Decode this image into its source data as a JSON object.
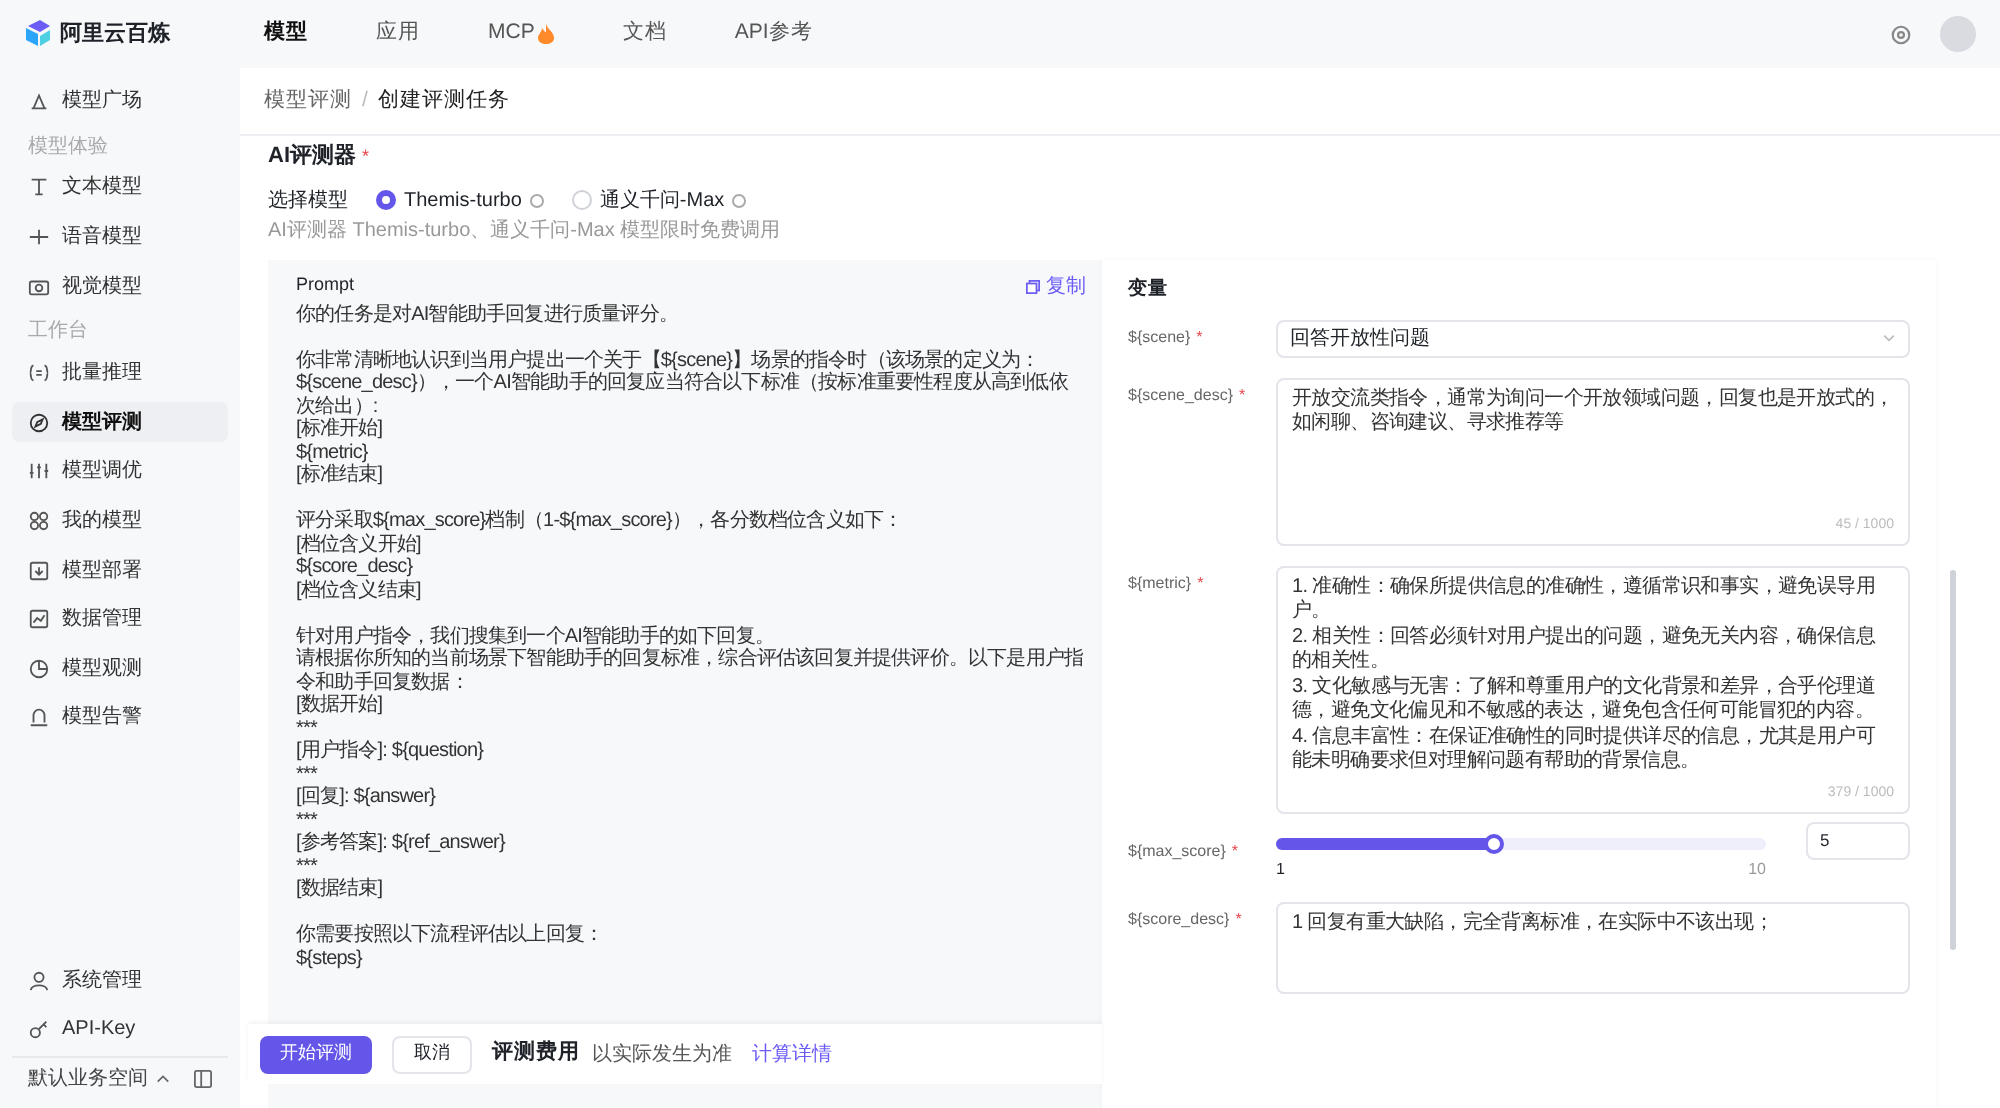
{
  "brand": "阿里云百炼",
  "top_nav": [
    {
      "label": "模型",
      "selected": true,
      "hot": false
    },
    {
      "label": "应用",
      "selected": false,
      "hot": false
    },
    {
      "label": "MCP",
      "selected": false,
      "hot": true
    },
    {
      "label": "文档",
      "selected": false,
      "hot": false
    },
    {
      "label": "API参考",
      "selected": false,
      "hot": false
    }
  ],
  "sidebar": {
    "groups": [
      {
        "items": [
          {
            "label": "模型广场",
            "selected": false
          }
        ]
      },
      {
        "heading": "模型体验",
        "items": [
          {
            "label": "文本模型",
            "selected": false
          },
          {
            "label": "语音模型",
            "selected": false
          },
          {
            "label": "视觉模型",
            "selected": false
          }
        ]
      },
      {
        "heading": "工作台",
        "items": [
          {
            "label": "批量推理",
            "selected": false
          },
          {
            "label": "模型评测",
            "selected": true
          },
          {
            "label": "模型调优",
            "selected": false
          },
          {
            "label": "我的模型",
            "selected": false
          },
          {
            "label": "模型部署",
            "selected": false
          },
          {
            "label": "数据管理",
            "selected": false
          },
          {
            "label": "模型观测",
            "selected": false
          },
          {
            "label": "模型告警",
            "selected": false
          }
        ]
      }
    ],
    "bottom_items": [
      {
        "label": "系统管理"
      },
      {
        "label": "API-Key"
      }
    ],
    "workspace": "默认业务空间"
  },
  "breadcrumb": {
    "items": [
      "模型评测",
      "创建评测任务"
    ],
    "separator": "/"
  },
  "evaluator": {
    "title": "AI评测器",
    "required_mark": "*",
    "label": "选择模型",
    "options": [
      {
        "label": "Themis-turbo",
        "selected": true
      },
      {
        "label": "通义千问-Max",
        "selected": false
      }
    ],
    "hint": "AI评测器 Themis-turbo、通义千问-Max 模型限时免费调用"
  },
  "prompt": {
    "title": "Prompt",
    "copy": "复制",
    "paragraphs": [
      [
        "你的任务是对AI智能助手回复进行质量评分。"
      ],
      [
        "你非常清晰地认识到当用户提出一个关于【${scene}】场景的指令时（该场景的定义为：${scene_desc}），一个AI智能助手的回复应当符合以下标准（按标准重要性程度从高到低依次给出）:",
        "[标准开始]",
        "${metric}",
        "[标准结束]"
      ],
      [
        "评分采取${max_score}档制（1-${max_score}），各分数档位含义如下：",
        "[档位含义开始]",
        "${score_desc}",
        "[档位含义结束]"
      ],
      [
        "针对用户指令，我们搜集到一个AI智能助手的如下回复。",
        "请根据你所知的当前场景下智能助手的回复标准，综合评估该回复并提供评价。以下是用户指令和助手回复数据：",
        "[数据开始]",
        "***",
        "[用户指令]: ${question}",
        "***",
        "[回复]: ${answer}",
        "***",
        "[参考答案]: ${ref_answer}",
        "***",
        "[数据结束]"
      ],
      [
        "你需要按照以下流程评估以上回复：",
        "${steps}"
      ]
    ]
  },
  "variables": {
    "title": "变量",
    "rows": [
      {
        "kind": "select",
        "name": "${scene}",
        "required_mark": "*",
        "value": "回答开放性问题"
      },
      {
        "kind": "textarea",
        "name": "${scene_desc}",
        "required_mark": "*",
        "value": "开放交流类指令，通常为询问一个开放领域问题，回复也是开放式的，如闲聊、咨询建议、寻求推荐等",
        "count": "45 / 1000"
      },
      {
        "kind": "textarea",
        "name": "${metric}",
        "required_mark": "*",
        "value": "1. 准确性：确保所提供信息的准确性，遵循常识和事实，避免误导用户。\n2. 相关性：回答必须针对用户提出的问题，避免无关内容，确保信息的相关性。\n3. 文化敏感与无害：了解和尊重用户的文化背景和差异，合乎伦理道德，避免文化偏见和不敏感的表达，避免包含任何可能冒犯的内容。\n4. 信息丰富性：在保证准确性的同时提供详尽的信息，尤其是用户可能未明确要求但对理解问题有帮助的背景信息。",
        "count": "379 / 1000"
      },
      {
        "kind": "slider",
        "name": "${max_score}",
        "required_mark": "*",
        "level": 0.444,
        "min": "1",
        "max": "10",
        "value": "5"
      },
      {
        "kind": "textarea",
        "name": "${score_desc}",
        "required_mark": "*",
        "value": "1 回复有重大缺陷，完全背离标准，在实际中不该出现；"
      }
    ]
  },
  "footer": {
    "primary": "开始评测",
    "cancel": "取消",
    "cost_label": "评测费用",
    "cost_note": "以实际发生为准",
    "link": "计算详情"
  }
}
